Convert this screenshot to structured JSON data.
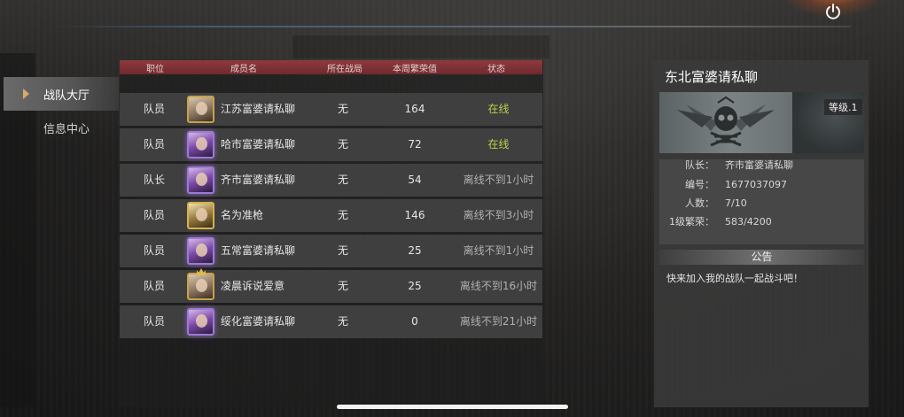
{
  "nav": {
    "items": [
      {
        "label": "战队大厅",
        "active": true
      },
      {
        "label": "信息中心",
        "active": false
      }
    ]
  },
  "roster": {
    "headers": [
      "职位",
      "成员名",
      "所在战局",
      "本周繁荣值",
      "状态"
    ],
    "rows": [
      {
        "role": "队员",
        "name": "江苏富婆请私聊",
        "match": "无",
        "prosperity": "164",
        "status": "在线",
        "online": true
      },
      {
        "role": "队员",
        "name": "哈市富婆请私聊",
        "match": "无",
        "prosperity": "72",
        "status": "在线",
        "online": true
      },
      {
        "role": "队长",
        "name": "齐市富婆请私聊",
        "match": "无",
        "prosperity": "54",
        "status": "离线不到1小时",
        "online": false
      },
      {
        "role": "队员",
        "name": "名为准枪",
        "match": "无",
        "prosperity": "146",
        "status": "离线不到3小时",
        "online": false
      },
      {
        "role": "队员",
        "name": "五常富婆请私聊",
        "match": "无",
        "prosperity": "25",
        "status": "离线不到1小时",
        "online": false
      },
      {
        "role": "队员",
        "name": "凌晨诉说爱意",
        "match": "无",
        "prosperity": "25",
        "status": "离线不到16小时",
        "online": false
      },
      {
        "role": "队员",
        "name": "绥化富婆请私聊",
        "match": "无",
        "prosperity": "0",
        "status": "离线不到21小时",
        "online": false
      }
    ]
  },
  "team": {
    "name": "东北富婆请私聊",
    "level": "等级.1",
    "captain_label": "队长：",
    "captain": "齐市富婆请私聊",
    "id_label": "编号：",
    "id": "1677037097",
    "members_label": "人数：",
    "members": "7/10",
    "prosperity_label": "1级繁荣：",
    "prosperity": "583/4200",
    "notice_title": "公告",
    "notice_text": "快来加入我的战队一起战斗吧！"
  },
  "colors": {
    "header_red": "#8e3a3e",
    "online_green": "#b9d24a",
    "nav_arrow": "#d8a868"
  },
  "icons": [
    "power-icon",
    "nav-arrow-icon",
    "skull-emblem-icon"
  ]
}
